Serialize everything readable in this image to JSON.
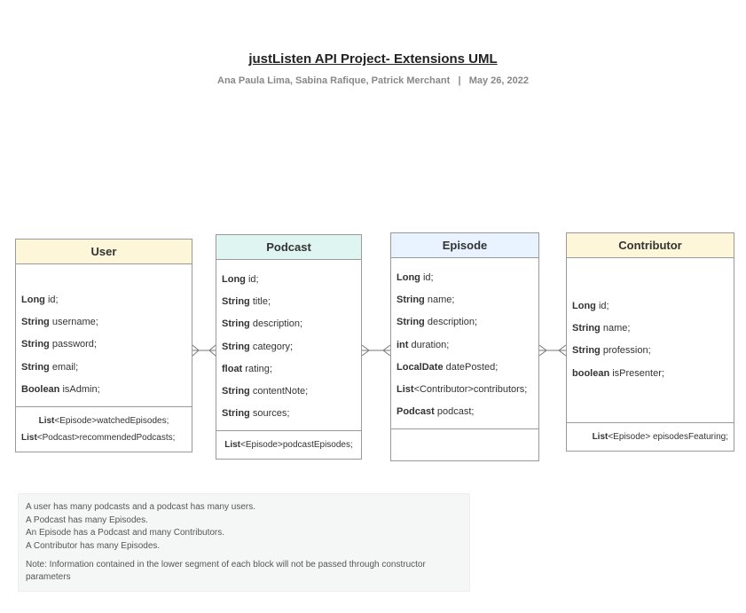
{
  "header": {
    "title": "justListen API Project- Extensions UML",
    "authors": "Ana Paula Lima, Sabina Rafique, Patrick Merchant",
    "sep": "|",
    "date": "May 26, 2022"
  },
  "classes": {
    "user": {
      "title": "User",
      "attrs": [
        {
          "type": "Long",
          "name": "id;"
        },
        {
          "type": "String",
          "name": "username;"
        },
        {
          "type": "String",
          "name": "password;"
        },
        {
          "type": "String",
          "name": "email;"
        },
        {
          "type": "Boolean",
          "name": "isAdmin;"
        }
      ],
      "foot": [
        {
          "type": "List",
          "generic": "<Episode>watchedEpisodes;"
        },
        {
          "type": "List",
          "generic": "<Podcast>recommendedPodcasts;"
        }
      ]
    },
    "podcast": {
      "title": "Podcast",
      "attrs": [
        {
          "type": "Long",
          "name": "id;"
        },
        {
          "type": "String",
          "name": "title;"
        },
        {
          "type": "String",
          "name": "description;"
        },
        {
          "type": "String",
          "name": "category;"
        },
        {
          "type": "float",
          "name": "rating;"
        },
        {
          "type": "String",
          "name": "contentNote;"
        },
        {
          "type": "String",
          "name": "sources;"
        }
      ],
      "foot": [
        {
          "type": "List",
          "generic": "<Episode>podcastEpisodes;"
        }
      ]
    },
    "episode": {
      "title": "Episode",
      "attrs": [
        {
          "type": "Long",
          "name": "id;"
        },
        {
          "type": "String",
          "name": "name;"
        },
        {
          "type": "String",
          "name": "description;"
        },
        {
          "type": "int",
          "name": "duration;"
        },
        {
          "type": "LocalDate",
          "name": "datePosted;"
        },
        {
          "type": "List",
          "name": "<Contributor>contributors;"
        },
        {
          "type": "Podcast",
          "name": "podcast;"
        }
      ],
      "foot": []
    },
    "contributor": {
      "title": "Contributor",
      "attrs": [
        {
          "type": "Long",
          "name": "id;"
        },
        {
          "type": "String",
          "name": "name;"
        },
        {
          "type": "String",
          "name": "profession;"
        },
        {
          "type": "boolean",
          "name": "isPresenter;"
        }
      ],
      "foot": [
        {
          "type": "List",
          "generic": "<Episode> episodesFeaturing;"
        }
      ]
    }
  },
  "notes": {
    "l1": "A user has many podcasts and a podcast has many users.",
    "l2": "A Podcast has many Episodes.",
    "l3": "An Episode has a Podcast and many Contributors.",
    "l4": "A Contributor has many Episodes.",
    "l5": "Note: Information contained in the lower segment of each block will not be passed through constructor parameters"
  }
}
